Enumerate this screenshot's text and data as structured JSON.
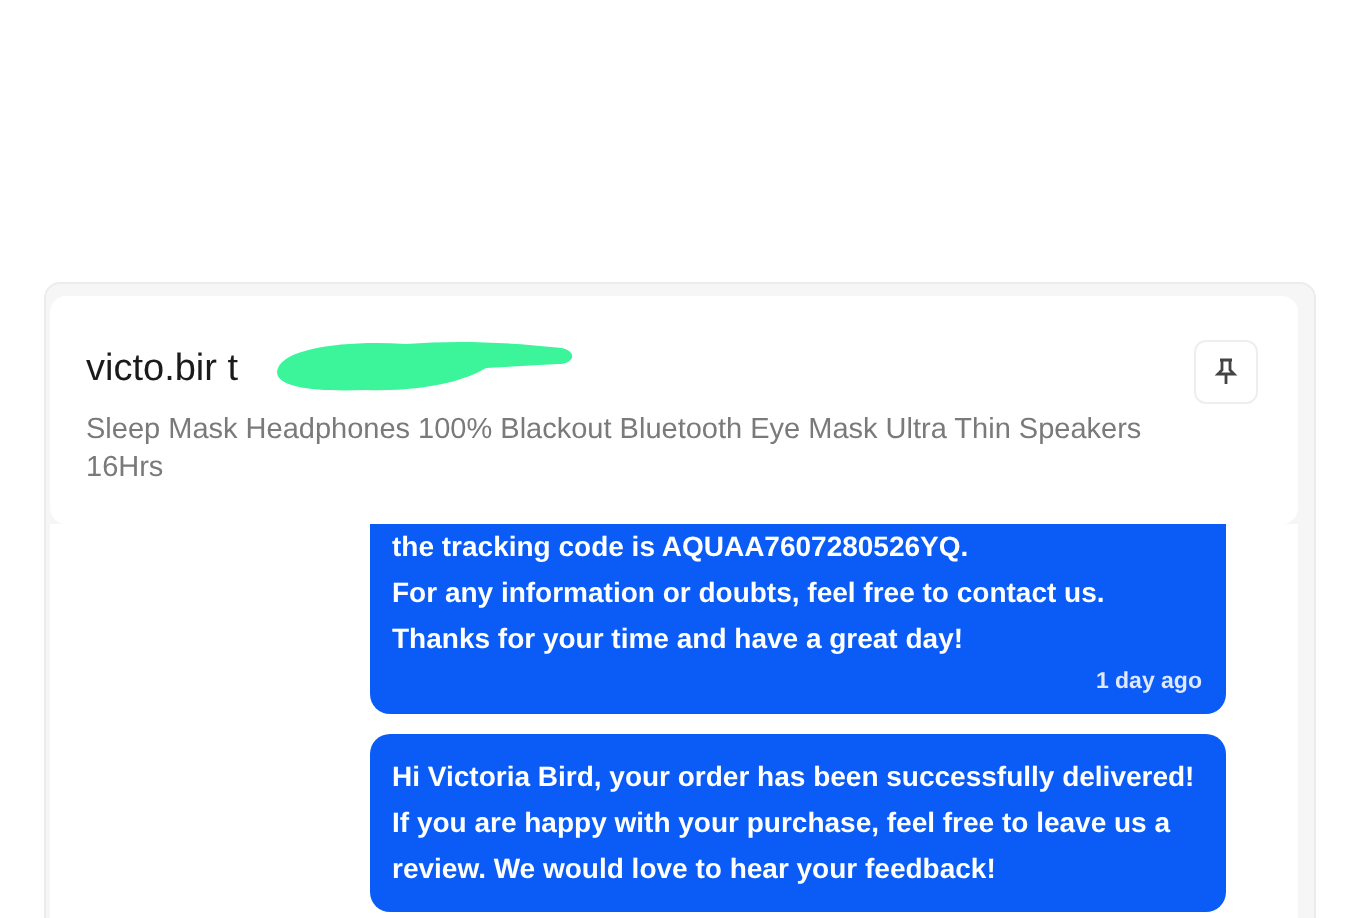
{
  "header": {
    "title": "victo.bir t",
    "redacted": true,
    "subtitle": "Sleep Mask Headphones 100% Blackout Bluetooth Eye Mask Ultra Thin Speakers 16Hrs"
  },
  "messages": [
    {
      "lines": [
        "the tracking code is AQUAA7607280526YQ.",
        "For any information or doubts, feel free to contact us.",
        "Thanks for your time and have a great day!"
      ],
      "time": "1 day ago"
    },
    {
      "lines": [
        "Hi Victoria Bird, your order has been successfully delivered!",
        "If you are happy with your purchase, feel free to leave us a review. We would love to hear your feedback!"
      ]
    }
  ]
}
